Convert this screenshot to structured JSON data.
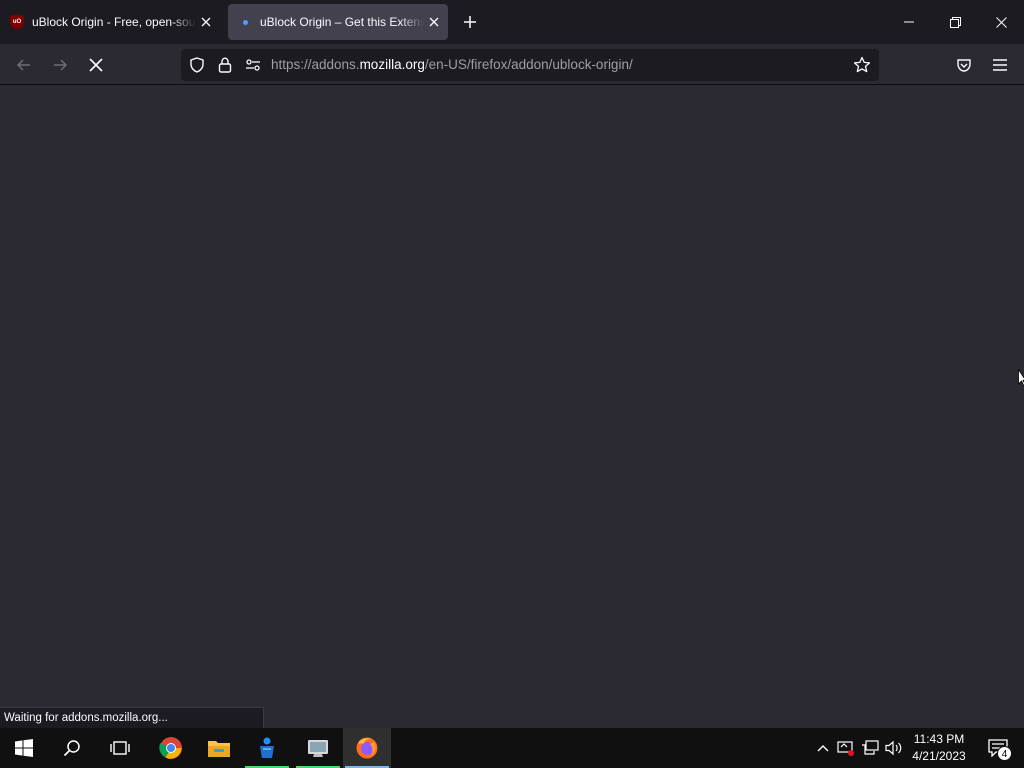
{
  "browser": {
    "tabs": [
      {
        "title": "uBlock Origin - Free, open-source ad content blocker.",
        "favicon": "ublock-origin-icon",
        "active": false
      },
      {
        "title": "uBlock Origin – Get this Extension for Firefox",
        "favicon": "loading-icon",
        "active": true
      }
    ],
    "url": {
      "prefix": "https://addons.",
      "domain": "mozilla.org",
      "path": "/en-US/firefox/addon/ublock-origin/"
    },
    "status_text": "Waiting for addons.mozilla.org..."
  },
  "taskbar": {
    "apps": [
      "start-icon",
      "search-icon",
      "task-view-icon",
      "chrome-icon",
      "file-explorer-icon",
      "app-icon",
      "app-icon",
      "firefox-icon"
    ],
    "clock": {
      "time": "11:43 PM",
      "date": "4/21/2023"
    },
    "notification_count": "4"
  },
  "colors": {
    "tabstrip": "#1c1b22",
    "toolbar": "#2b2a33",
    "active_tab": "#42414d",
    "urlbar": "#1c1b22",
    "taskbar": "#101010",
    "accent": "#76b9ed"
  }
}
